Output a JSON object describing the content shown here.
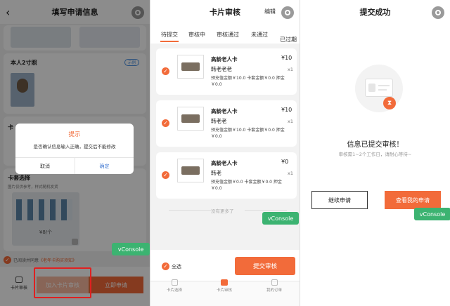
{
  "panel1": {
    "title": "填写申请信息",
    "photo_label": "本人2寸照",
    "photo_badge": "示例",
    "card_set_title": "卡套选择",
    "card_set_sub": "图片仅供参考，样式随机发货",
    "card_price": "¥8/个",
    "agree_text": "已阅读并同意",
    "agree_link": "《老年卡购买须知》",
    "bottom_icon_label": "卡片审核",
    "add_button": "加入卡片审核",
    "apply_button": "立即申请",
    "dialog": {
      "title": "提示",
      "message": "是否确认信息输入正确，提交后不能修改",
      "cancel": "取消",
      "confirm": "确定"
    },
    "side_text_1": "卡",
    "side_text_2": "卡"
  },
  "panel2": {
    "title": "卡片审核",
    "edit": "编辑",
    "tabs": [
      "待提交",
      "审核中",
      "审核通过",
      "未通过",
      "已过期"
    ],
    "items": [
      {
        "name": "高龄老人卡",
        "holder": "韩老老老",
        "price": "¥10",
        "qty": "x1",
        "detail": "预充值金额￥10.0 卡套金额￥0.0 押金￥0.0"
      },
      {
        "name": "高龄老人卡",
        "holder": "韩老老",
        "price": "¥10",
        "qty": "x1",
        "detail": "预充值金额￥10.0 卡套金额￥0.0 押金￥0.0"
      },
      {
        "name": "高龄老人卡",
        "holder": "韩老",
        "price": "¥0",
        "qty": "x1",
        "detail": "预充值金额￥0.0 卡套金额￥0.0 押金￥0.0"
      }
    ],
    "no_more": "没有更多了",
    "select_all": "全选",
    "submit": "提交审核",
    "bottom_tabs": [
      "卡片选择",
      "卡片审核",
      "我的订单"
    ]
  },
  "panel3": {
    "title": "提交成功",
    "headline": "信息已提交审核！",
    "sub": "审核需1~2个工作日，请耐心等待~",
    "continue": "继续申请",
    "view": "查看我的申请"
  },
  "vconsole": "vConsole",
  "colors": {
    "accent": "#f26b3a",
    "vconsole": "#3cb371"
  }
}
